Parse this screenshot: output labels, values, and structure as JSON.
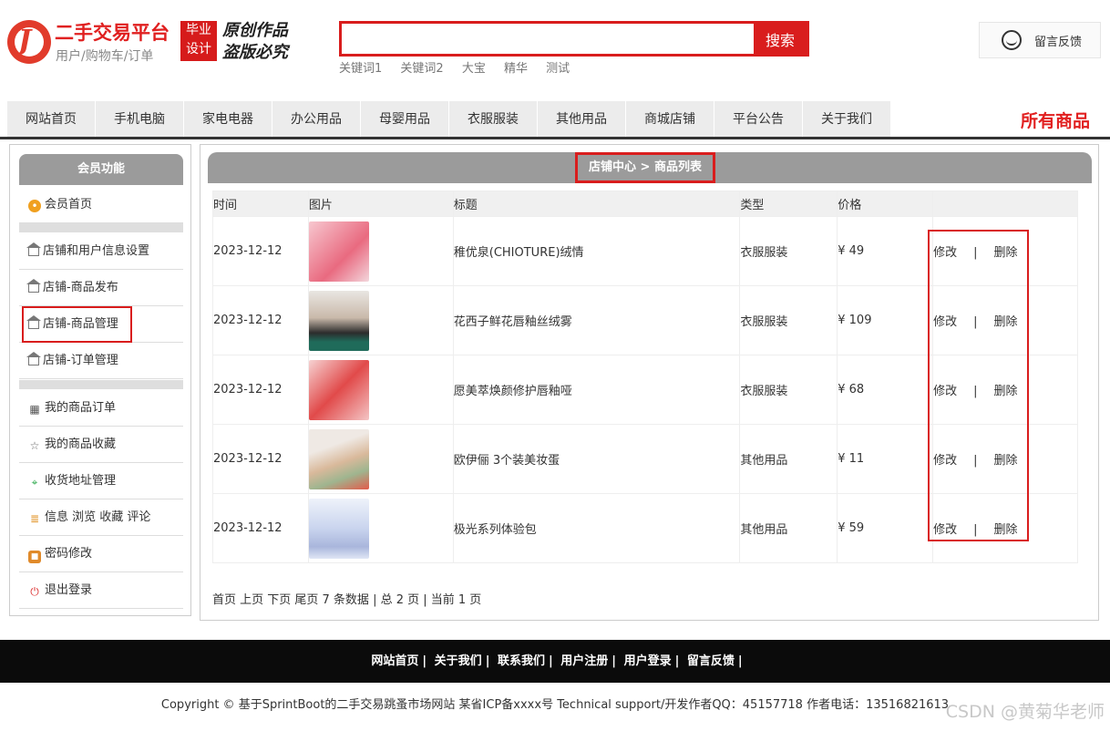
{
  "header": {
    "site_title": "二手交易平台",
    "site_sub": "用户/购物车/订单",
    "badge_line1": "毕业",
    "badge_line2": "设计",
    "slogan_line1": "原创作品",
    "slogan_line2": "盗版必究",
    "search_button": "搜索",
    "search_value": "",
    "keywords": [
      "关键词1",
      "关键词2",
      "大宝",
      "精华",
      "测试"
    ],
    "feedback": "留言反馈"
  },
  "nav": {
    "items": [
      "网站首页",
      "手机电脑",
      "家电电器",
      "办公用品",
      "母婴用品",
      "衣服服装",
      "其他用品",
      "商城店铺",
      "平台公告",
      "关于我们"
    ],
    "all_goods": "所有商品"
  },
  "sidebar": {
    "title": "会员功能",
    "items": [
      {
        "label": "会员首页",
        "icon": "member-icon"
      },
      {
        "label": "店铺和用户信息设置",
        "icon": "home-icon"
      },
      {
        "label": "店铺-商品发布",
        "icon": "home-icon"
      },
      {
        "label": "店铺-商品管理",
        "icon": "home-icon"
      },
      {
        "label": "店铺-订单管理",
        "icon": "home-icon"
      },
      {
        "label": "我的商品订单",
        "icon": "grid-icon"
      },
      {
        "label": "我的商品收藏",
        "icon": "star-icon"
      },
      {
        "label": "收货地址管理",
        "icon": "location-icon"
      },
      {
        "label": "信息 浏览 收藏 评论",
        "icon": "document-icon"
      },
      {
        "label": "密码修改",
        "icon": "lock-icon"
      },
      {
        "label": "退出登录",
        "icon": "power-icon"
      }
    ]
  },
  "main": {
    "breadcrumb": "店铺中心 > 商品列表",
    "columns": [
      "时间",
      "图片",
      "标题",
      "类型",
      "价格"
    ],
    "rows": [
      {
        "time": "2023-12-12",
        "title": "稚优泉(CHIOTURE)绒情",
        "type": "衣服服装",
        "price": "¥ 49",
        "image": "lipstick-pink-image"
      },
      {
        "time": "2023-12-12",
        "title": "花西子鲜花唇釉丝绒雾",
        "type": "衣服服装",
        "price": "¥ 109",
        "image": "model-lipglaze-image"
      },
      {
        "time": "2023-12-12",
        "title": "愿美萃焕颜修护唇釉哑",
        "type": "衣服服装",
        "price": "¥ 68",
        "image": "lipgloss-red-image"
      },
      {
        "time": "2023-12-12",
        "title": "欧伊俪 3个装美妆蛋",
        "type": "其他用品",
        "price": "¥ 11",
        "image": "beauty-egg-image"
      },
      {
        "time": "2023-12-12",
        "title": "极光系列体验包",
        "type": "其他用品",
        "price": "¥ 59",
        "image": "skincare-set-image"
      }
    ],
    "edit_label": "修改",
    "delete_label": "删除",
    "op_sep": "|",
    "pager": "首页 上页 下页 尾页 7 条数据 | 总 2 页 | 当前 1 页"
  },
  "footer": {
    "links": [
      "网站首页",
      "关于我们",
      "联系我们",
      "用户注册",
      "用户登录",
      "留言反馈"
    ],
    "copyright": "Copyright © 基于SprintBoot的二手交易跳蚤市场网站    某省ICP备xxxx号    Technical support/开发作者QQ：45157718    作者电话：13516821613",
    "watermark": "CSDN @黄菊华老师"
  },
  "colors": {
    "accent": "#d91d1d",
    "panel_head": "#9b9b9b",
    "footer_bg": "#0b0b0b"
  }
}
